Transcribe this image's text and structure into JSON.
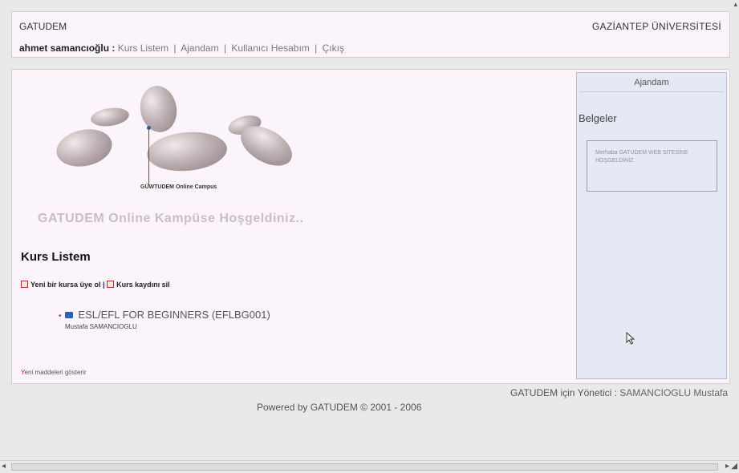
{
  "header": {
    "site_name": "GATUDEM",
    "university": "GAZİANTEP ÜNİVERSİTESİ",
    "user_name": "ahmet samancıoğlu :",
    "nav": {
      "kurs_listem": "Kurs Listem",
      "ajandam": "Ajandam",
      "hesabim": "Kullanıcı Hesabım",
      "cikis": "Çıkış",
      "separator": "|"
    }
  },
  "hero": {
    "caption": "GÜWTUDEM Online Campus"
  },
  "main": {
    "welcome": "GATUDEM Online Kampüse Hoşgeldiniz..",
    "section_title": "Kurs Listem",
    "actions": {
      "enroll": "Yeni bir kursa üye ol",
      "separator": "|",
      "unenroll": "Kurs kaydını sil"
    },
    "course": {
      "title": "ESL/EFL FOR BEGINNERS (EFLBG001)",
      "teacher": "Mustafa SAMANCIOGLU"
    },
    "new_items": {
      "first_letter": "Y",
      "rest": "eni maddeleri gösterir"
    }
  },
  "sidebar": {
    "title": "Ajandam",
    "section": "Belgeler",
    "note": "Merhaba GATUDEM WEB SİTESİNE HOŞGELDİNİZ"
  },
  "footer": {
    "admin_label": "GATUDEM için Yönetici :",
    "admin_name": "SAMANCIOGLU Mustafa",
    "powered": "Powered by GATUDEM © 2001 - 2006"
  },
  "icons": {
    "scroll_left": "scroll-left-arrow-icon",
    "scroll_right": "scroll-right-arrow-icon",
    "cursor": "mouse-pointer-icon"
  }
}
